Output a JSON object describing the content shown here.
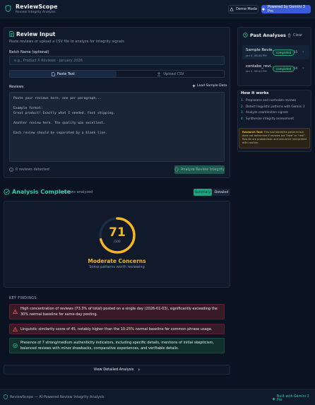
{
  "app": {
    "title": "ReviewScope",
    "subtitle": "Review Integrity Analysis",
    "demo_label": "Demo Mode",
    "gemini_label": "Powered by Gemini 3 Pro"
  },
  "review_input": {
    "title": "Review Input",
    "description": "Paste reviews or upload a CSV file to analyze for integrity signals",
    "batch_label": "Batch Name (optional)",
    "batch_placeholder": "e.g., Product X Reviews - January 2026",
    "tab_paste": "Paste Text",
    "tab_upload": "Upload CSV",
    "reviews_label": "Reviews",
    "load_sample": "Load Sample Data",
    "textarea_placeholder": "Paste your reviews here, one per paragraph...\n\nExample format:\nGreat product! Exactly what I needed. Fast shipping.\n\nAnother review here. The quality was excellent.\n\nEach review should be separated by a blank line.",
    "detected": "0 reviews detected",
    "analyze_button": "Analyze Review Integrity"
  },
  "past_analyses": {
    "title": "Past Analyses",
    "clear_label": "Clear",
    "items": [
      {
        "name": "Sample Revie...",
        "date": "Jan 5, 08:46 PM",
        "status": "completed",
        "count": "15"
      },
      {
        "name": "contabo_revi...",
        "date": "Jan 5, 08:43 PM",
        "status": "completed",
        "count": "50"
      }
    ]
  },
  "how_it_works": {
    "title": "How it works",
    "steps": [
      {
        "n": "1.",
        "text": "Preprocess and normalize reviews"
      },
      {
        "n": "2.",
        "text": "Detect linguistic patterns with Gemini 3"
      },
      {
        "n": "3.",
        "text": "Analyze coordination signals"
      },
      {
        "n": "4.",
        "text": "Synthesize integrity assessment"
      }
    ],
    "research_title": "Research Tool:",
    "research_text": " This tool identifies patterns but does not determine if reviews are \"fake\" or \"real\". Results are probabilistic and should be interpreted with caution."
  },
  "analysis": {
    "title": "Analysis Complete",
    "count_text": "15 reviews analyzed",
    "tab_summary": "Summary",
    "tab_detailed": "Detailed",
    "score": "71",
    "score_max": "/100",
    "score_fraction": 0.71,
    "verdict": "Moderate Concerns",
    "verdict_sub": "Some patterns worth reviewing",
    "accent": "#f5b822"
  },
  "findings": {
    "title": "KEY FINDINGS",
    "items": [
      {
        "type": "warning",
        "text": "High concentration of reviews (73.3% of total) posted on a single day (2026-01-03), significantly exceeding the 30% normal baseline for same-day posting."
      },
      {
        "type": "warning",
        "text": "Linguistic similarity score of 45, notably higher than the 10-25% normal baseline for common phrase usage."
      },
      {
        "type": "positive",
        "text": "Presence of 7 strong/medium authenticity indicators, including specific details, mentions of initial skepticism, balanced reviews with minor drawbacks, comparative experiences, and verifiable details."
      }
    ]
  },
  "view_detailed": "View Detailed Analysis",
  "footer": {
    "left": "ReviewScope — AI-Powered Review Integrity Analysis",
    "right": "Built with Gemini 3 Pro"
  }
}
